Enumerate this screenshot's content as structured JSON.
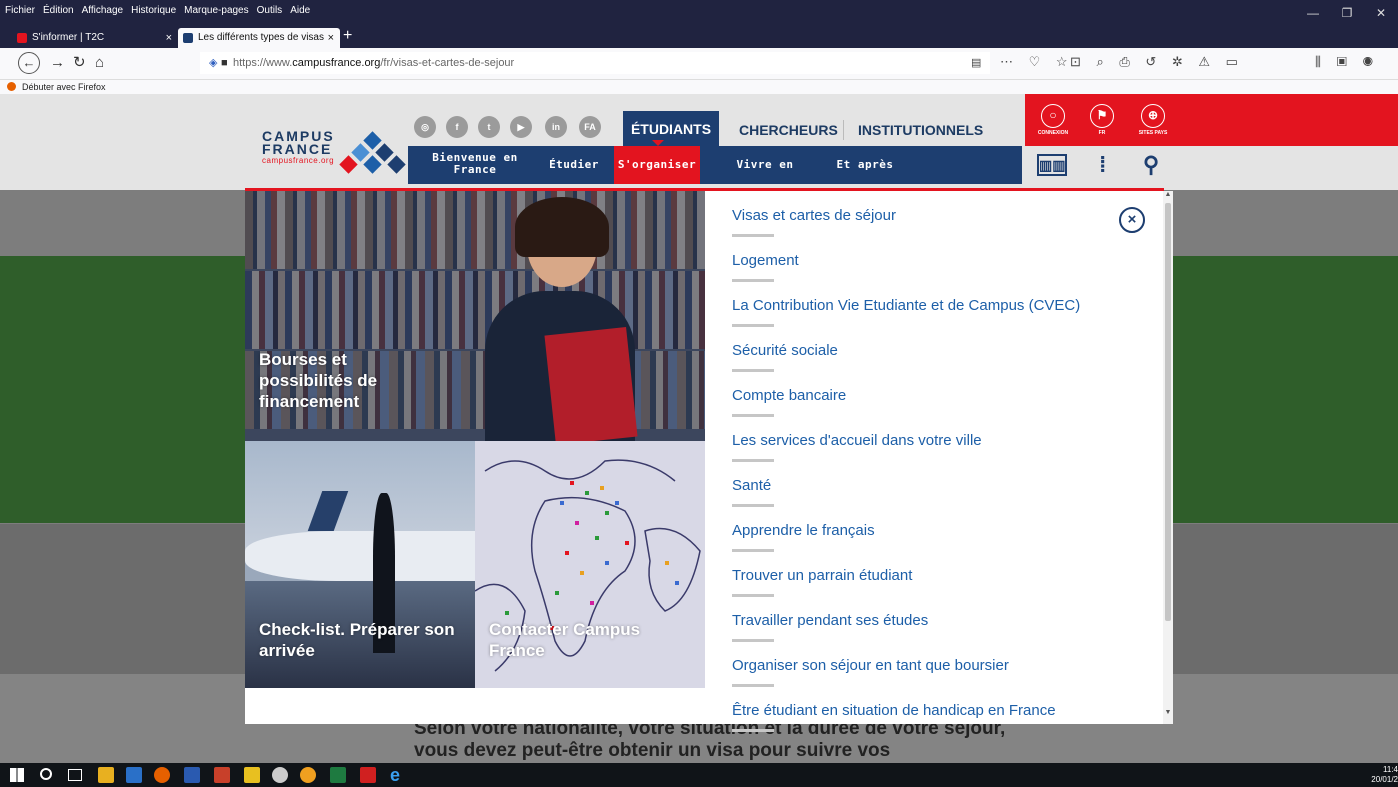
{
  "browser": {
    "menu": [
      "Fichier",
      "Édition",
      "Affichage",
      "Historique",
      "Marque-pages",
      "Outils",
      "Aide"
    ],
    "tabs": [
      {
        "title": "S'informer | T2C",
        "close": "×"
      },
      {
        "title": "Les différents types de visas étu",
        "close": "×"
      }
    ],
    "new_tab": "+",
    "url_prefix": "https://www.",
    "url_domain": "campusfrance.org",
    "url_path": "/fr/visas-et-cartes-de-sejour",
    "bookmark": "Débuter avec Firefox",
    "window_controls": [
      "—",
      "❐",
      "✕"
    ]
  },
  "site": {
    "logo": {
      "line1": "CAMPUS",
      "line2": "FRANCE",
      "line3": "campusfrance.org"
    },
    "social": [
      "◎",
      "f",
      "t",
      "▶",
      "in",
      "FA"
    ],
    "top_tabs": [
      "ÉTUDIANTS",
      "CHERCHEURS",
      "INSTITUTIONNELS"
    ],
    "sub_nav": [
      "Bienvenue en France",
      "Étudier",
      "S'organiser",
      "Vivre en France",
      "Et après"
    ],
    "red_buttons": [
      {
        "label": "CONNEXION",
        "icon": "user-icon"
      },
      {
        "label": "FR",
        "icon": "flag-icon"
      },
      {
        "label": "SITES PAYS",
        "icon": "globe-icon"
      }
    ],
    "tools": [
      "book-icon",
      "pipe-icon",
      "search-icon"
    ]
  },
  "mega_menu": {
    "tiles": [
      {
        "title": "Bourses et possibilités de financement"
      },
      {
        "title": "Check-list. Préparer son arrivée"
      },
      {
        "title": "Contacter Campus France"
      }
    ],
    "links": [
      "Visas et cartes de séjour",
      "Logement",
      "La Contribution Vie Etudiante et de Campus (CVEC)",
      "Sécurité sociale",
      "Compte bancaire",
      "Les services d'accueil dans votre ville",
      "Santé",
      "Apprendre le français",
      "Trouver un parrain étudiant",
      "Travailler pendant ses études",
      "Organiser son séjour en tant que boursier",
      "Être étudiant en situation de handicap en France"
    ],
    "close": "×"
  },
  "background_text": "Selon votre nationalité, votre situation et la durée de votre séjour, vous devez peut-être obtenir un visa pour suivre vos",
  "taskbar": {
    "time": "11:4",
    "date": "20/01/2"
  }
}
